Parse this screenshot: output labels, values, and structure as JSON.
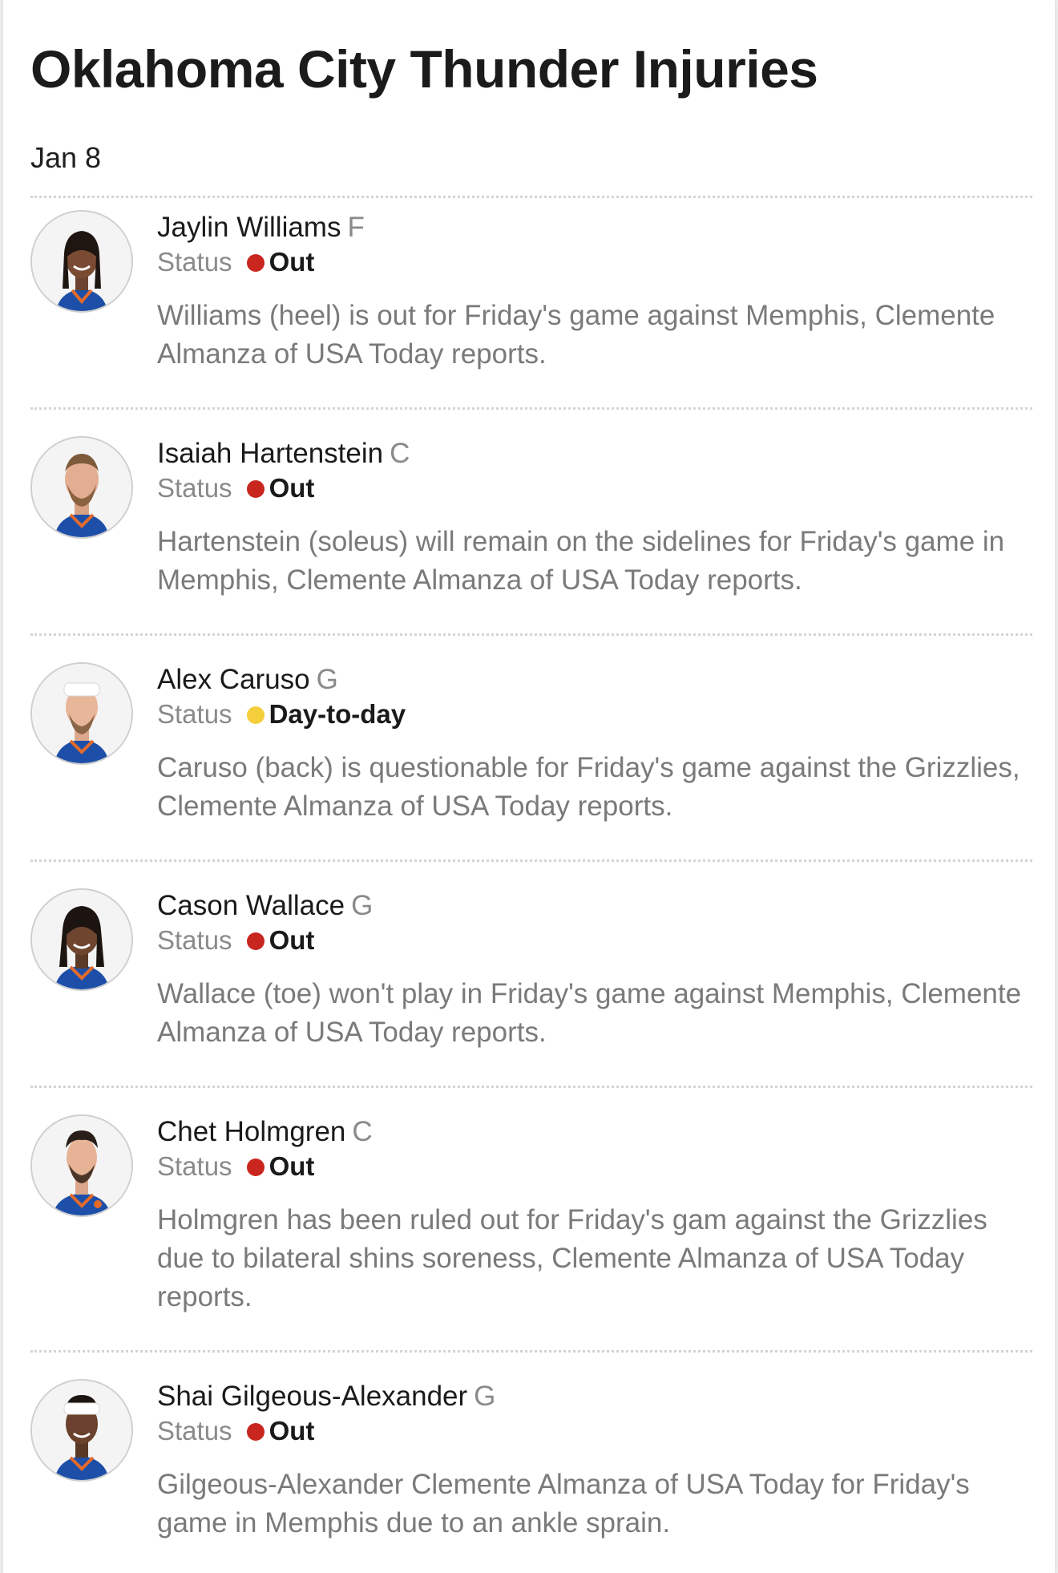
{
  "page": {
    "title": "Oklahoma City Thunder Injuries",
    "date": "Jan 8",
    "status_label": "Status"
  },
  "colors": {
    "out": "#c8261f",
    "day_to_day": "#f5cf3b"
  },
  "players": [
    {
      "name": "Jaylin Williams",
      "position": "F",
      "status": "Out",
      "status_color": "#c8261f",
      "note": "Williams (heel) is out for Friday's game against Memphis, Clemente Almanza of USA Today reports.",
      "avatar_icon": "player-headshot-icon"
    },
    {
      "name": "Isaiah Hartenstein",
      "position": "C",
      "status": "Out",
      "status_color": "#c8261f",
      "note": "Hartenstein (soleus) will remain on the sidelines for Friday's game in Memphis, Clemente Almanza of USA Today reports.",
      "avatar_icon": "player-headshot-icon"
    },
    {
      "name": "Alex Caruso",
      "position": "G",
      "status": "Day-to-day",
      "status_color": "#f5cf3b",
      "note": "Caruso (back) is questionable for Friday's game against the Grizzlies, Clemente Almanza of USA Today reports.",
      "avatar_icon": "player-headshot-icon"
    },
    {
      "name": "Cason Wallace",
      "position": "G",
      "status": "Out",
      "status_color": "#c8261f",
      "note": "Wallace (toe) won't play in Friday's game against Memphis, Clemente Almanza of USA Today reports.",
      "avatar_icon": "player-headshot-icon"
    },
    {
      "name": "Chet Holmgren",
      "position": "C",
      "status": "Out",
      "status_color": "#c8261f",
      "note": "Holmgren has been ruled out for Friday's gam against the Grizzlies due to bilateral shins soreness, Clemente Almanza of USA Today reports.",
      "avatar_icon": "player-headshot-icon"
    },
    {
      "name": "Shai Gilgeous-Alexander",
      "position": "G",
      "status": "Out",
      "status_color": "#c8261f",
      "note": "Gilgeous-Alexander Clemente Almanza of USA Today for Friday's game in Memphis due to an ankle sprain.",
      "avatar_icon": "player-headshot-icon"
    }
  ]
}
